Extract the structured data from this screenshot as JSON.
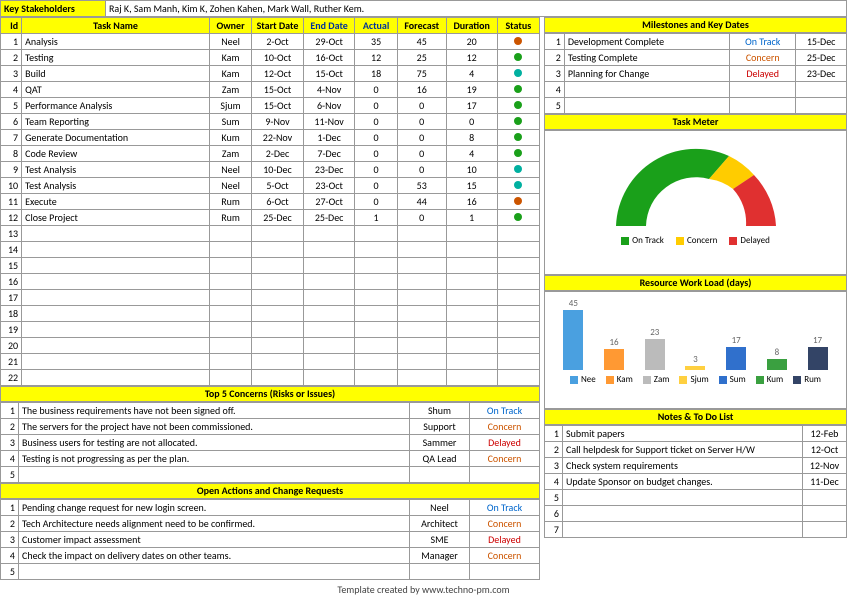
{
  "stakeholders": {
    "label": "Key Stakeholders",
    "value": "Raj K, Sam Manh, Kim K, Zohen Kahen, Mark Wall, Ruther Kem."
  },
  "task_table": {
    "headers": {
      "id": "Id",
      "name": "Task Name",
      "owner": "Owner",
      "start": "Start Date",
      "end": "End Date",
      "actual": "Actual",
      "forecast": "Forecast",
      "duration": "Duration",
      "status": "Status"
    },
    "rows": [
      {
        "id": "1",
        "name": "Analysis",
        "owner": "Neel",
        "start": "2-Oct",
        "end": "29-Oct",
        "actual": "35",
        "forecast": "45",
        "duration": "20",
        "dot": "orange"
      },
      {
        "id": "2",
        "name": "Testing",
        "owner": "Kam",
        "start": "10-Oct",
        "end": "16-Oct",
        "actual": "12",
        "forecast": "25",
        "duration": "12",
        "dot": "green"
      },
      {
        "id": "3",
        "name": "Build",
        "owner": "Kam",
        "start": "12-Oct",
        "end": "15-Oct",
        "actual": "18",
        "forecast": "75",
        "duration": "4",
        "dot": "cyan"
      },
      {
        "id": "4",
        "name": "QAT",
        "owner": "Zam",
        "start": "15-Oct",
        "end": "4-Nov",
        "actual": "0",
        "forecast": "16",
        "duration": "19",
        "dot": "green"
      },
      {
        "id": "5",
        "name": "Performance Analysis",
        "owner": "Sjum",
        "start": "15-Oct",
        "end": "6-Nov",
        "actual": "0",
        "forecast": "0",
        "duration": "17",
        "dot": "green"
      },
      {
        "id": "6",
        "name": "Team Reporting",
        "owner": "Sum",
        "start": "9-Nov",
        "end": "11-Nov",
        "actual": "0",
        "forecast": "0",
        "duration": "0",
        "dot": "green"
      },
      {
        "id": "7",
        "name": "Generate Documentation",
        "owner": "Kum",
        "start": "22-Nov",
        "end": "1-Dec",
        "actual": "0",
        "forecast": "0",
        "duration": "8",
        "dot": "green"
      },
      {
        "id": "8",
        "name": "Code Review",
        "owner": "Zam",
        "start": "2-Dec",
        "end": "7-Dec",
        "actual": "0",
        "forecast": "0",
        "duration": "4",
        "dot": "green"
      },
      {
        "id": "9",
        "name": "Test Analysis",
        "owner": "Neel",
        "start": "10-Dec",
        "end": "23-Dec",
        "actual": "0",
        "forecast": "0",
        "duration": "10",
        "dot": "cyan"
      },
      {
        "id": "10",
        "name": "Test Analysis",
        "owner": "Neel",
        "start": "5-Oct",
        "end": "23-Oct",
        "actual": "0",
        "forecast": "53",
        "duration": "15",
        "dot": "cyan"
      },
      {
        "id": "11",
        "name": "Execute",
        "owner": "Rum",
        "start": "6-Oct",
        "end": "27-Oct",
        "actual": "0",
        "forecast": "44",
        "duration": "16",
        "dot": "orange"
      },
      {
        "id": "12",
        "name": "Close Project",
        "owner": "Rum",
        "start": "25-Dec",
        "end": "25-Dec",
        "actual": "1",
        "forecast": "0",
        "duration": "1",
        "dot": "green"
      },
      {
        "id": "13"
      },
      {
        "id": "14"
      },
      {
        "id": "15"
      },
      {
        "id": "16"
      },
      {
        "id": "17"
      },
      {
        "id": "18"
      },
      {
        "id": "19"
      },
      {
        "id": "20"
      },
      {
        "id": "21"
      },
      {
        "id": "22"
      }
    ]
  },
  "concerns": {
    "title": "Top 5 Concerns (Risks or Issues)",
    "rows": [
      {
        "id": "1",
        "text": "The business requirements have not been signed off.",
        "owner": "Shum",
        "status": "On Track",
        "cls": "status-ontrack"
      },
      {
        "id": "2",
        "text": "The servers for the project have not been commissioned.",
        "owner": "Support",
        "status": "Concern",
        "cls": "status-concern"
      },
      {
        "id": "3",
        "text": "Business users for testing are not allocated.",
        "owner": "Sammer",
        "status": "Delayed",
        "cls": "status-delayed"
      },
      {
        "id": "4",
        "text": "Testing is not progressing as per the plan.",
        "owner": "QA Lead",
        "status": "Concern",
        "cls": "status-concern"
      },
      {
        "id": "5",
        "text": ""
      }
    ]
  },
  "actions": {
    "title": "Open Actions and Change Requests",
    "rows": [
      {
        "id": "1",
        "text": "Pending change request for new login screen.",
        "owner": "Neel",
        "status": "On Track",
        "cls": "status-ontrack"
      },
      {
        "id": "2",
        "text": "Tech Architecture needs alignment need to be confirmed.",
        "owner": "Architect",
        "status": "Concern",
        "cls": "status-concern"
      },
      {
        "id": "3",
        "text": "Customer impact assessment",
        "owner": "SME",
        "status": "Delayed",
        "cls": "status-delayed"
      },
      {
        "id": "4",
        "text": "Check the impact on delivery dates on other teams.",
        "owner": "Manager",
        "status": "Concern",
        "cls": "status-concern"
      },
      {
        "id": "5",
        "text": ""
      }
    ]
  },
  "milestones": {
    "title": "Milestones and Key Dates",
    "rows": [
      {
        "id": "1",
        "name": "Development Complete",
        "status": "On Track",
        "cls": "status-ontrack",
        "date": "15-Dec"
      },
      {
        "id": "2",
        "name": "Testing Complete",
        "status": "Concern",
        "cls": "status-concern",
        "date": "25-Dec"
      },
      {
        "id": "3",
        "name": "Planning for Change",
        "status": "Delayed",
        "cls": "status-delayed",
        "date": "23-Dec"
      },
      {
        "id": "4"
      },
      {
        "id": "5"
      }
    ]
  },
  "task_meter": {
    "title": "Task Meter",
    "legend": [
      "On Track",
      "Concern",
      "Delayed"
    ]
  },
  "workload": {
    "title": "Resource Work Load (days)"
  },
  "notes": {
    "title": "Notes & To Do List",
    "rows": [
      {
        "id": "1",
        "text": "Submit papers",
        "date": "12-Feb"
      },
      {
        "id": "2",
        "text": "Call helpdesk for Support ticket on Server H/W",
        "date": "12-Oct"
      },
      {
        "id": "3",
        "text": "Check system requirements",
        "date": "12-Nov"
      },
      {
        "id": "4",
        "text": "Update Sponsor on budget changes.",
        "date": "11-Dec"
      },
      {
        "id": "5"
      },
      {
        "id": "6"
      },
      {
        "id": "7"
      }
    ]
  },
  "chart_data": [
    {
      "type": "pie",
      "title": "Task Meter",
      "categories": [
        "On Track",
        "Concern",
        "Delayed"
      ],
      "values": [
        60,
        15,
        25
      ],
      "colors": [
        "#1aa01a",
        "#ffcc00",
        "#e03030"
      ],
      "note": "semi-donut gauge"
    },
    {
      "type": "bar",
      "title": "Resource Work Load (days)",
      "categories": [
        "Nee",
        "Kam",
        "Zam",
        "Sjum",
        "Sum",
        "Kum",
        "Rum"
      ],
      "values": [
        45,
        16,
        23,
        3,
        17,
        8,
        17
      ],
      "colors": [
        "#4aa0e0",
        "#ff9933",
        "#bbbbbb",
        "#ffd040",
        "#3070cc",
        "#3aa040",
        "#334466"
      ],
      "ylabel": "days"
    }
  ],
  "footer": "Template created by www.techno-pm.com"
}
